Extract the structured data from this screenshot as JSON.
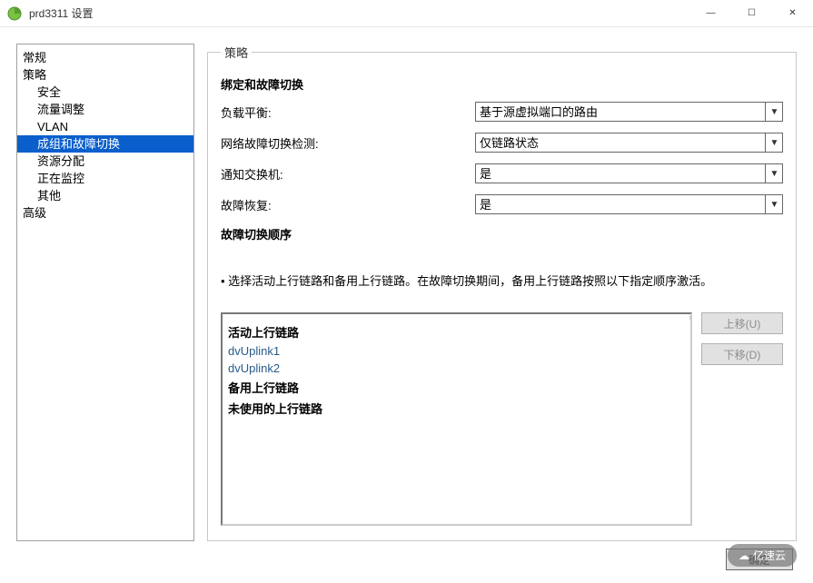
{
  "window": {
    "title": "prd3311 设置",
    "icon_name": "vsphere-icon"
  },
  "nav": {
    "items": [
      {
        "label": "常规",
        "level": 0,
        "selected": false
      },
      {
        "label": "策略",
        "level": 0,
        "selected": false
      },
      {
        "label": "安全",
        "level": 1,
        "selected": false
      },
      {
        "label": "流量调整",
        "level": 1,
        "selected": false
      },
      {
        "label": "VLAN",
        "level": 1,
        "selected": false
      },
      {
        "label": "成组和故障切换",
        "level": 1,
        "selected": true
      },
      {
        "label": "资源分配",
        "level": 1,
        "selected": false
      },
      {
        "label": "正在监控",
        "level": 1,
        "selected": false
      },
      {
        "label": "其他",
        "level": 1,
        "selected": false
      },
      {
        "label": "高级",
        "level": 0,
        "selected": false
      }
    ]
  },
  "policy": {
    "legend": "策略",
    "teaming_header": "绑定和故障切换",
    "rows": {
      "load_balancing": {
        "label": "负载平衡:",
        "value": "基于源虚拟端口的路由"
      },
      "failure_detect": {
        "label": "网络故障切换检测:",
        "value": "仅链路状态"
      },
      "notify_switches": {
        "label": "通知交换机:",
        "value": "是"
      },
      "failback": {
        "label": "故障恢复:",
        "value": "是"
      }
    },
    "failover_header": "故障切换顺序",
    "failover_desc": "选择活动上行链路和备用上行链路。在故障切换期间，备用上行链路按照以下指定顺序激活。",
    "uplinks": {
      "active_label": "活动上行链路",
      "active_items": [
        "dvUplink1",
        "dvUplink2"
      ],
      "standby_label": "备用上行链路",
      "unused_label": "未使用的上行链路"
    },
    "move_up": "上移(U)",
    "move_down": "下移(D)"
  },
  "dialog_buttons": {
    "ok": "确定"
  },
  "watermark": "亿速云"
}
